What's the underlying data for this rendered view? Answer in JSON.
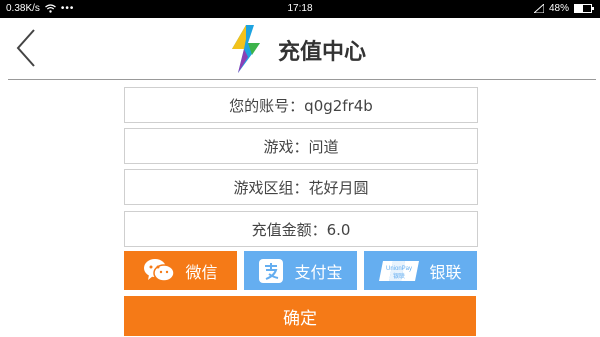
{
  "statusbar": {
    "speed": "0.38K/s",
    "time": "17:18",
    "battery": "48%",
    "battery_level": 0.48
  },
  "header": {
    "title": "充值中心"
  },
  "fields": {
    "account": "您的账号：q0g2fr4b",
    "game": "游戏：问道",
    "server": "游戏区组：花好月圆",
    "amount": "充值金额：6.0"
  },
  "payment": {
    "wechat": "微信",
    "alipay": "支付宝",
    "unionpay": "银联",
    "unionpay_logo_text": "UnionPay 银联"
  },
  "confirm_label": "确定",
  "colors": {
    "accent_orange": "#f57a17",
    "accent_blue": "#65aef0"
  }
}
